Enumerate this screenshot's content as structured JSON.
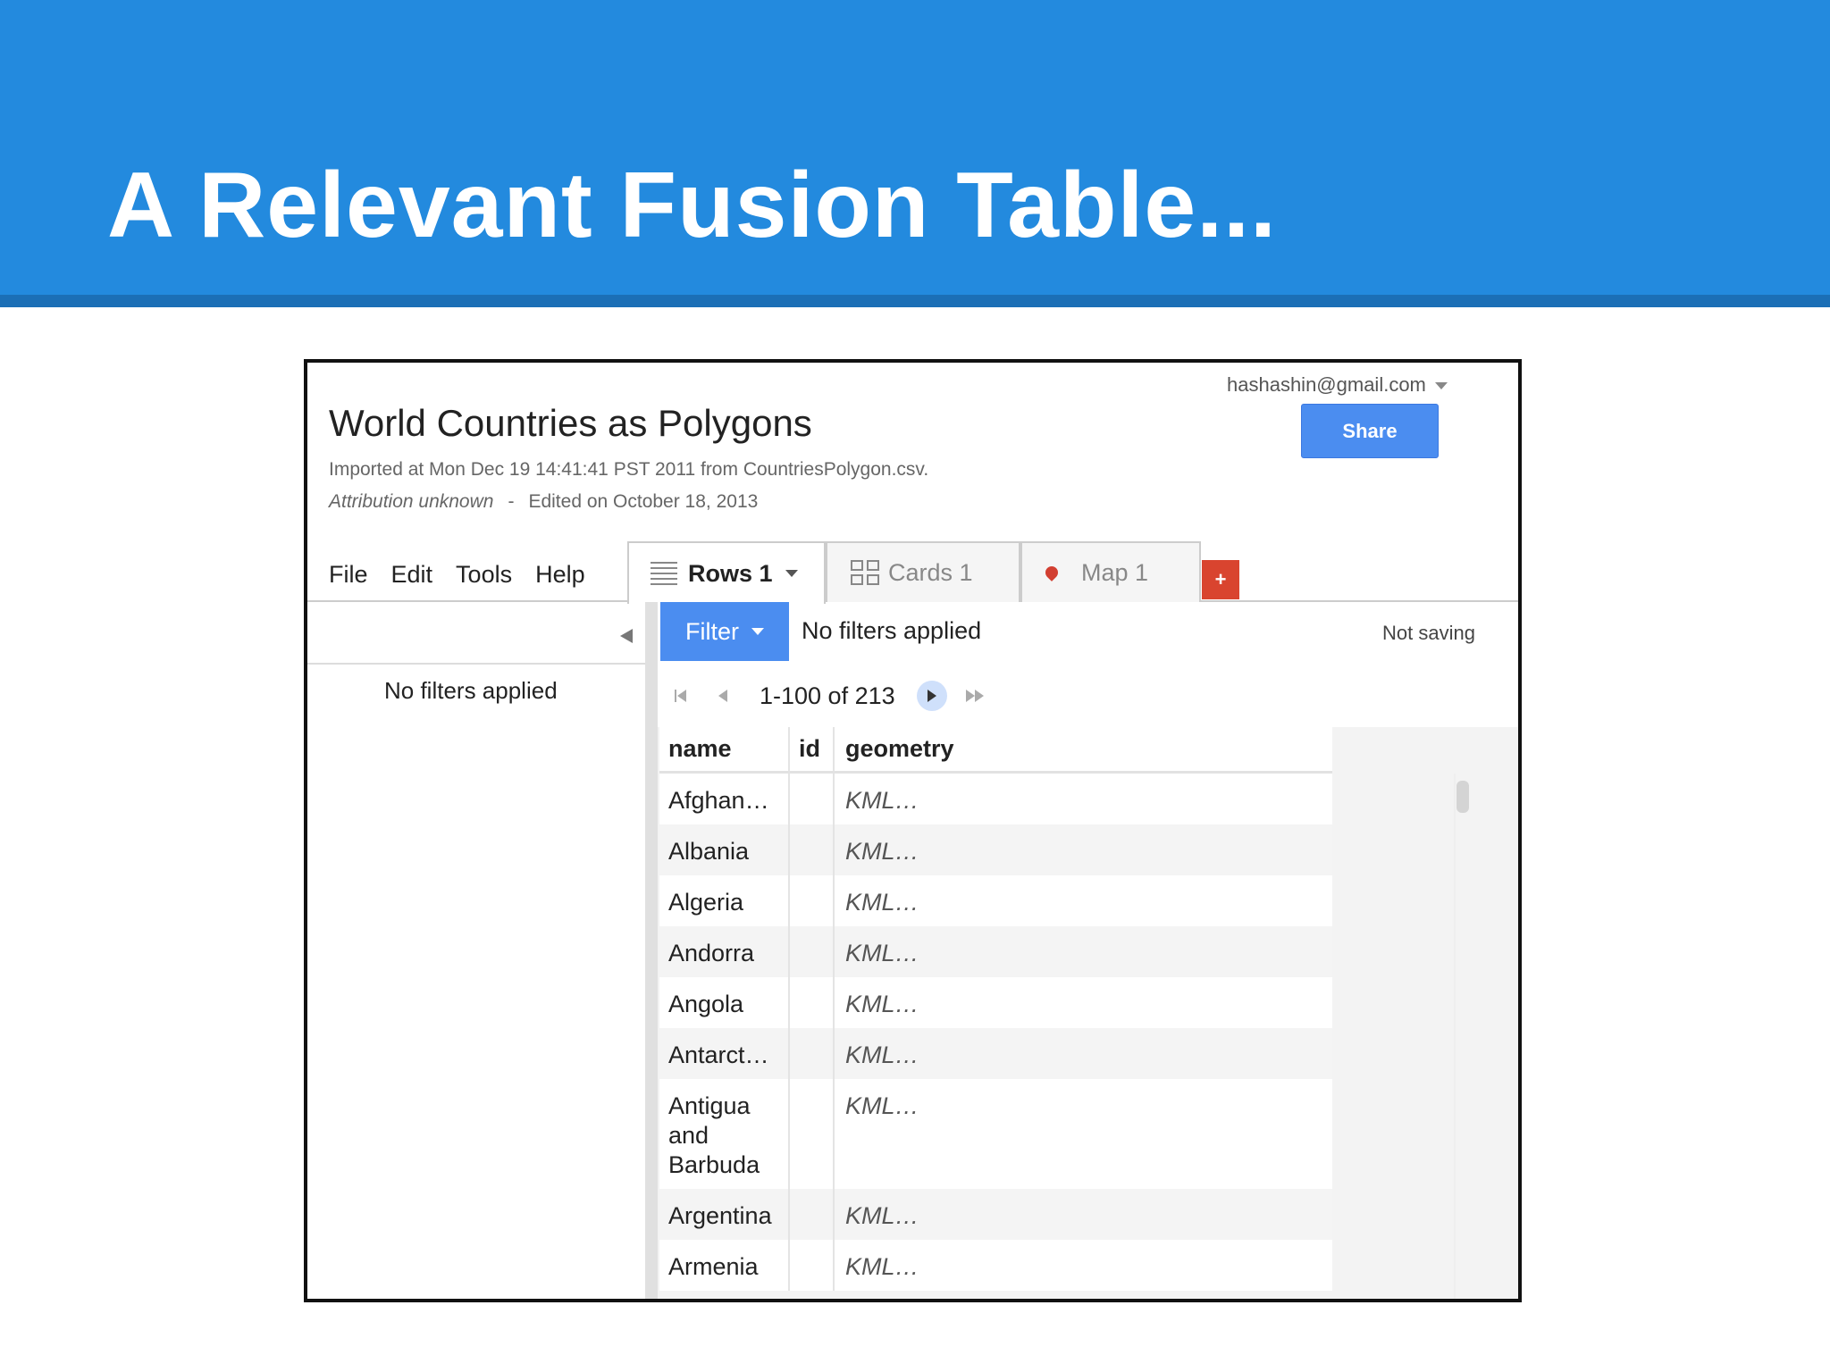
{
  "slide": {
    "title": "A Relevant Fusion Table..."
  },
  "header": {
    "account": "hashashin@gmail.com",
    "share_label": "Share",
    "doc_title": "World Countries as Polygons",
    "import_info": "Imported at Mon Dec 19 14:41:41 PST 2011 from CountriesPolygon.csv.",
    "attribution": "Attribution unknown",
    "separator": "-",
    "edited": "Edited on October 18, 2013"
  },
  "menu": [
    "File",
    "Edit",
    "Tools",
    "Help"
  ],
  "tabs": [
    {
      "label": "Rows 1",
      "active": true
    },
    {
      "label": "Cards 1",
      "active": false
    },
    {
      "label": "Map 1",
      "active": false
    }
  ],
  "add_tab_label": "+",
  "filter": {
    "button_label": "Filter",
    "status": "No filters applied",
    "left_panel_status": "No filters applied",
    "saving_status": "Not saving"
  },
  "pager": {
    "range": "1-100 of 213"
  },
  "table": {
    "columns": [
      "name",
      "id",
      "geometry"
    ],
    "rows": [
      {
        "name": "Afghan…",
        "id": "",
        "geometry": "KML…"
      },
      {
        "name": "Albania",
        "id": "",
        "geometry": "KML…"
      },
      {
        "name": "Algeria",
        "id": "",
        "geometry": "KML…"
      },
      {
        "name": "Andorra",
        "id": "",
        "geometry": "KML…"
      },
      {
        "name": "Angola",
        "id": "",
        "geometry": "KML…"
      },
      {
        "name": "Antarct…",
        "id": "",
        "geometry": "KML…"
      },
      {
        "name": "Antigua and Barbuda",
        "id": "",
        "geometry": "KML…"
      },
      {
        "name": "Argentina",
        "id": "",
        "geometry": "KML…"
      },
      {
        "name": "Armenia",
        "id": "",
        "geometry": "KML…"
      }
    ]
  },
  "colors": {
    "slide_blue": "#238ade",
    "accent_blue": "#4b8df0",
    "add_tab_red": "#d9442f"
  }
}
